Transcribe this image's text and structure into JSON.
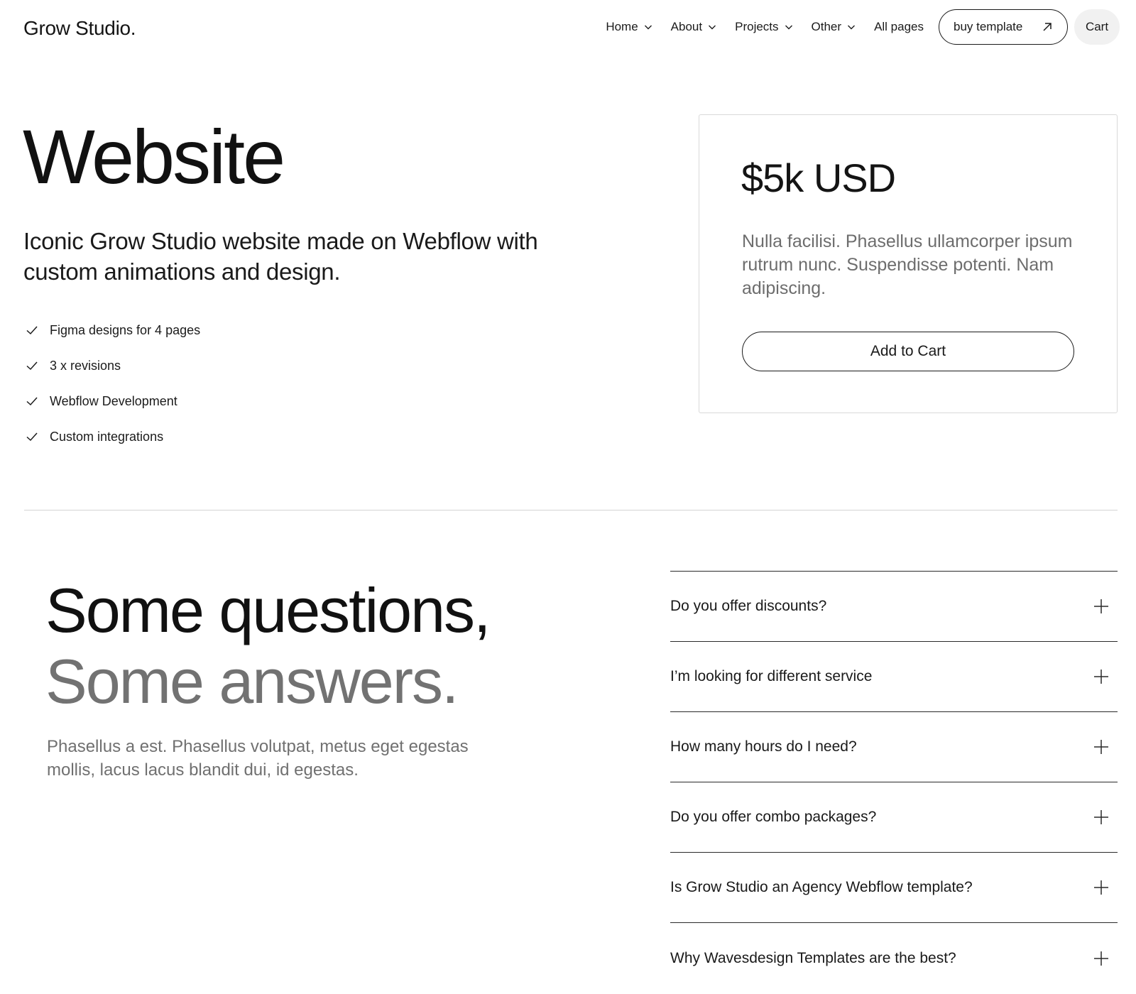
{
  "nav": {
    "brand": "Grow Studio.",
    "links": [
      {
        "label": "Home",
        "icon": "chevron-down-icon"
      },
      {
        "label": "About",
        "icon": "chevron-down-icon"
      },
      {
        "label": "Projects",
        "icon": "chevron-down-icon"
      },
      {
        "label": "Other",
        "icon": "chevron-down-icon"
      }
    ],
    "all_pages": "All pages",
    "buy_button": {
      "label": "buy template",
      "icon": "arrow-up-right-icon"
    },
    "cart_button": "Cart"
  },
  "hero": {
    "title": "Website",
    "subtitle": "Iconic Grow Studio website made on Webflow with custom animations and design.",
    "features": [
      "Figma designs for 4 pages",
      "3 x revisions",
      "Webflow Development",
      "Custom integrations"
    ],
    "feature_icon": "check-icon"
  },
  "price_card": {
    "price": "$5k USD",
    "description": "Nulla facilisi. Phasellus ullamcorper ipsum rutrum nunc. Suspendisse potenti. Nam adipiscing.",
    "button": "Add to Cart"
  },
  "faq": {
    "heading_line1": "Some questions,",
    "heading_line2": "Some answers.",
    "description": "Phasellus a est. Phasellus volutpat, metus eget egestas mollis, lacus lacus blandit dui, id egestas.",
    "toggle_icon": "plus-icon",
    "items": [
      "Do you offer discounts?",
      "I’m looking for different service",
      "How many hours do I need?",
      "Do you offer combo packages?",
      "Is Grow Studio an Agency Webflow template?",
      "Why Wavesdesign Templates are the best?"
    ]
  },
  "colors": {
    "text": "#141414",
    "muted": "#707070",
    "border": "#d9d9d9",
    "cart_bg": "#f1f1f1"
  }
}
